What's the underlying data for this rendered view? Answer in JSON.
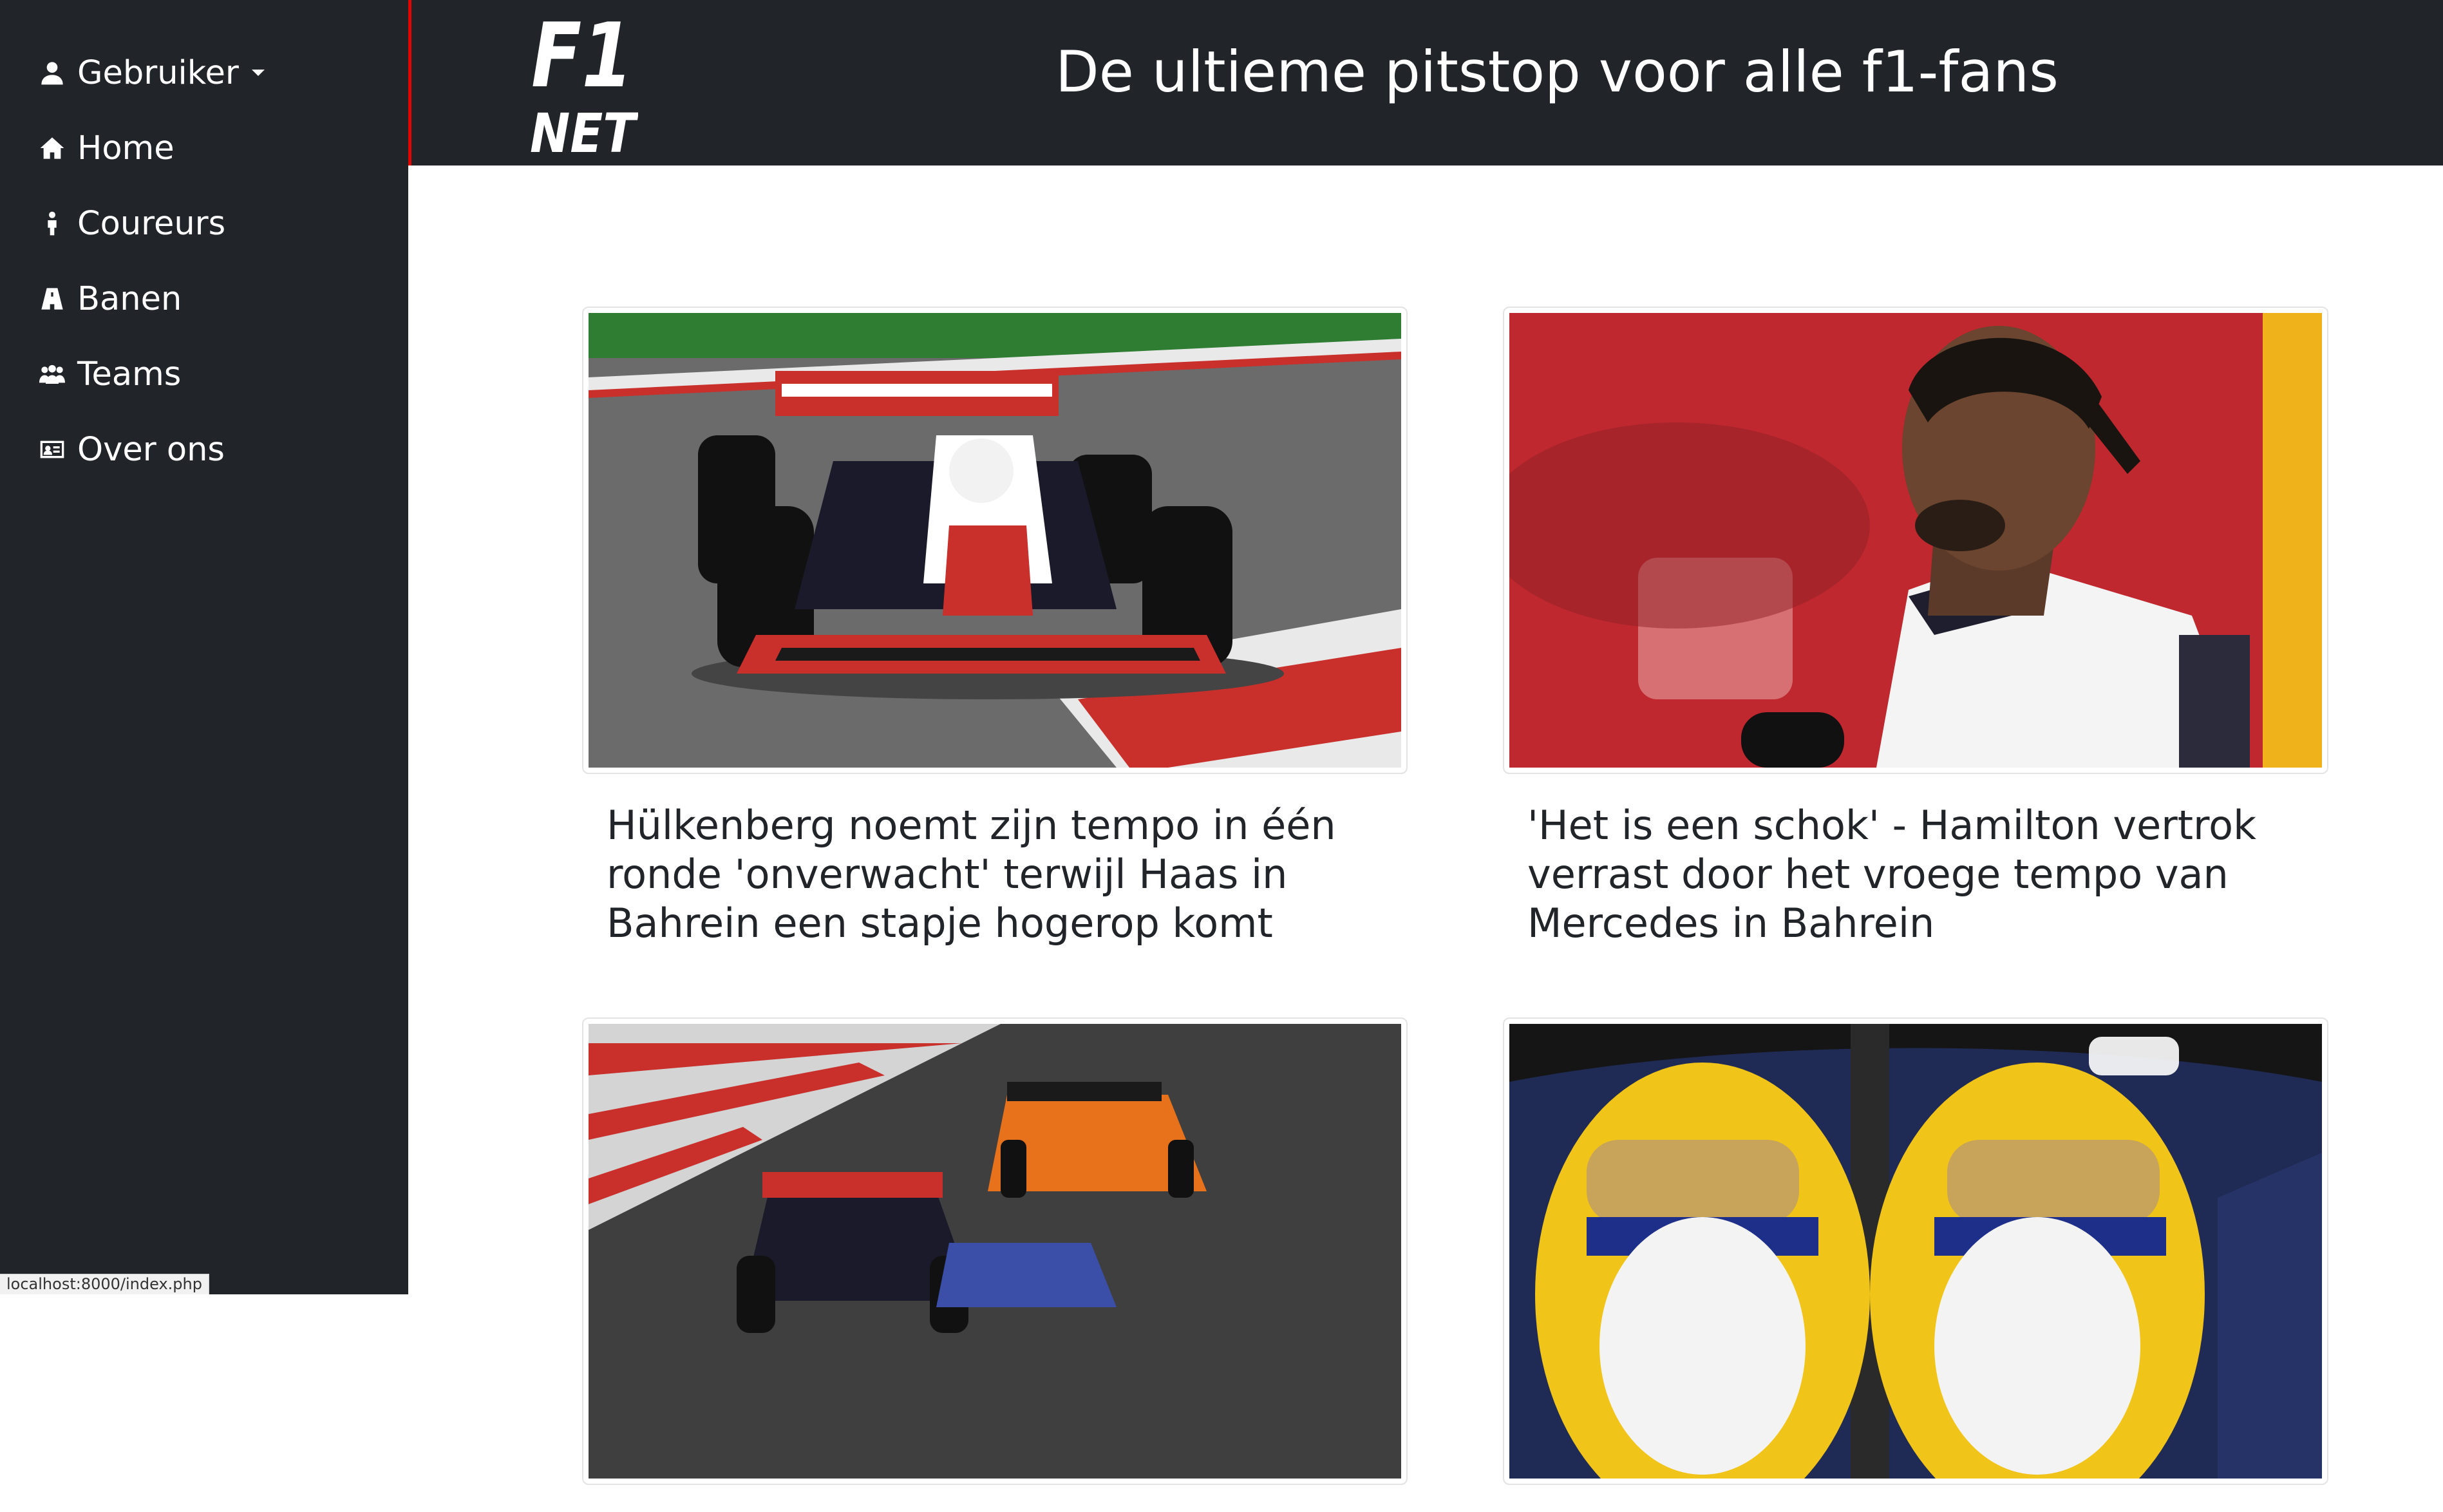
{
  "sidebar": {
    "items": [
      {
        "label": "Gebruiker",
        "icon": "user-icon",
        "dropdown": true
      },
      {
        "label": "Home",
        "icon": "home-icon"
      },
      {
        "label": "Coureurs",
        "icon": "driver-icon"
      },
      {
        "label": "Banen",
        "icon": "road-icon"
      },
      {
        "label": "Teams",
        "icon": "people-group-icon"
      },
      {
        "label": "Over ons",
        "icon": "id-card-icon"
      }
    ]
  },
  "header": {
    "logo_line1": "F1",
    "logo_line2": "NET",
    "title": "De ultieme pitstop voor alle f1-fans"
  },
  "articles": [
    {
      "title": "Hülkenberg noemt zijn tempo in één ronde 'onverwacht' terwijl Haas in Bahrein een stapje hogerop komt"
    },
    {
      "title": "'Het is een schok' - Hamilton vertrok verrast door het vroege tempo van Mercedes in Bahrein"
    },
    {
      "title": ""
    },
    {
      "title": ""
    }
  ],
  "status_bar": {
    "url": "localhost:8000/index.php"
  },
  "colors": {
    "sidebar_bg": "#212529",
    "accent": "#e10600",
    "text_dark": "#212529"
  }
}
